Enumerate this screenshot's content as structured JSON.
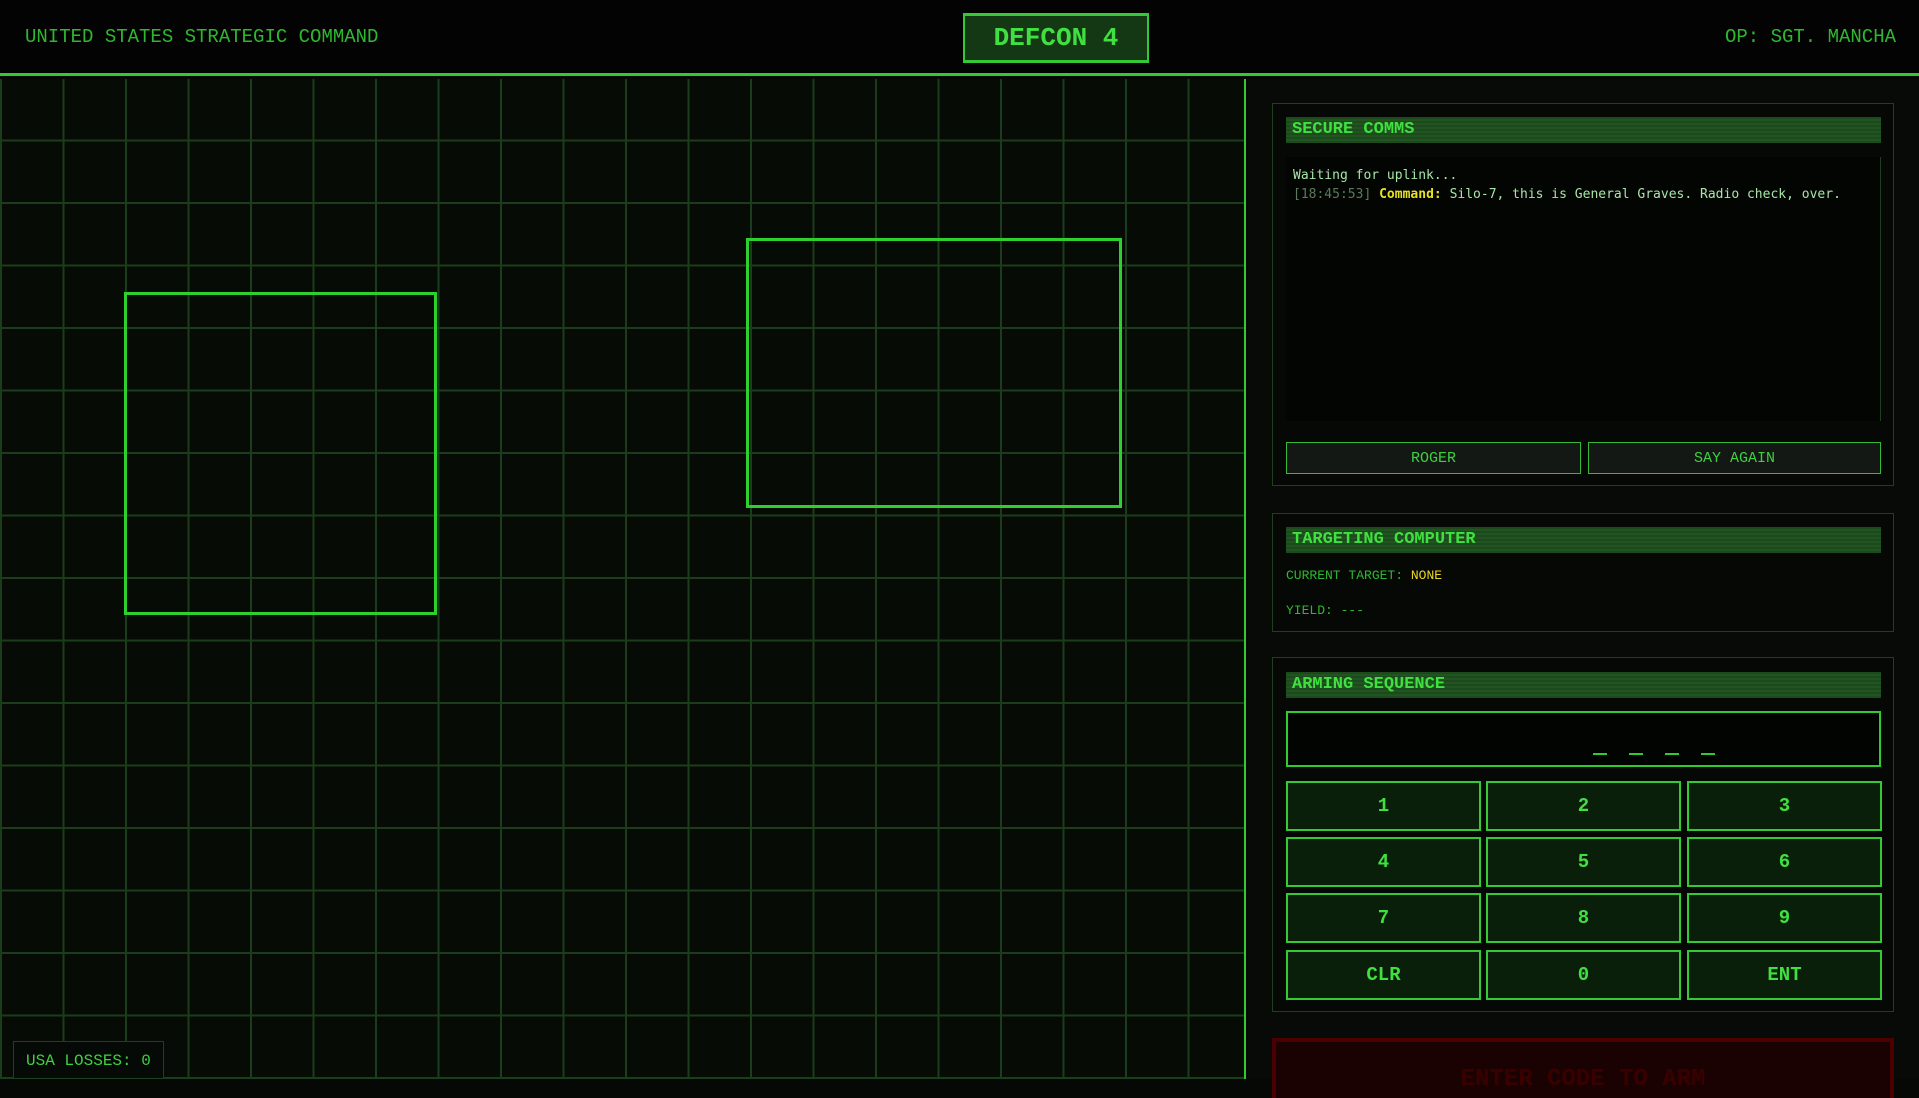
{
  "header": {
    "org": "UNITED STATES STRATEGIC COMMAND",
    "defcon": "DEFCON 4",
    "operator": "OP: SGT. MANCHA"
  },
  "map": {
    "losses": "USA LOSSES: 0"
  },
  "comms": {
    "title": "SECURE COMMS",
    "log": [
      {
        "text": "Waiting for uplink..."
      },
      {
        "time": "[18:45:53]",
        "speaker": "Command:",
        "text": "Silo-7, this is General Graves. Radio check, over."
      }
    ],
    "roger": "ROGER",
    "say_again": "SAY AGAIN"
  },
  "targeting": {
    "title": "TARGETING COMPUTER",
    "target_label": "CURRENT TARGET:",
    "target_value": "NONE",
    "yield_label": "YIELD:",
    "yield_value": "---"
  },
  "arming": {
    "title": "ARMING SEQUENCE",
    "code_slots": 4,
    "keys": [
      "1",
      "2",
      "3",
      "4",
      "5",
      "6",
      "7",
      "8",
      "9",
      "CLR",
      "0",
      "ENT"
    ],
    "arm_button": "ENTER CODE TO ARM"
  },
  "colors": {
    "accent": "#2ecc2e",
    "warning": "#e8d820",
    "danger": "#4a0000"
  }
}
